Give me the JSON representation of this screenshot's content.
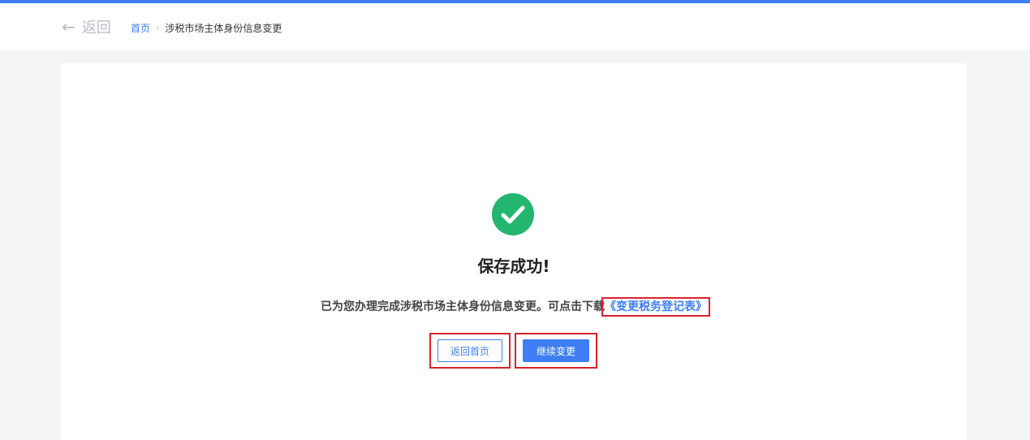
{
  "header": {
    "back_label": "返回",
    "breadcrumb": {
      "home": "首页",
      "separator": "›",
      "current": "涉税市场主体身份信息变更"
    }
  },
  "result": {
    "title": "保存成功!",
    "message": "已为您办理完成涉税市场主体身份信息变更。可点击下载",
    "download_link": "《变更税务登记表》"
  },
  "actions": {
    "home_label": "返回首页",
    "continue_label": "继续变更"
  },
  "colors": {
    "accent": "#3d7ef5",
    "success": "#22b66f",
    "highlight": "#d9232c"
  }
}
